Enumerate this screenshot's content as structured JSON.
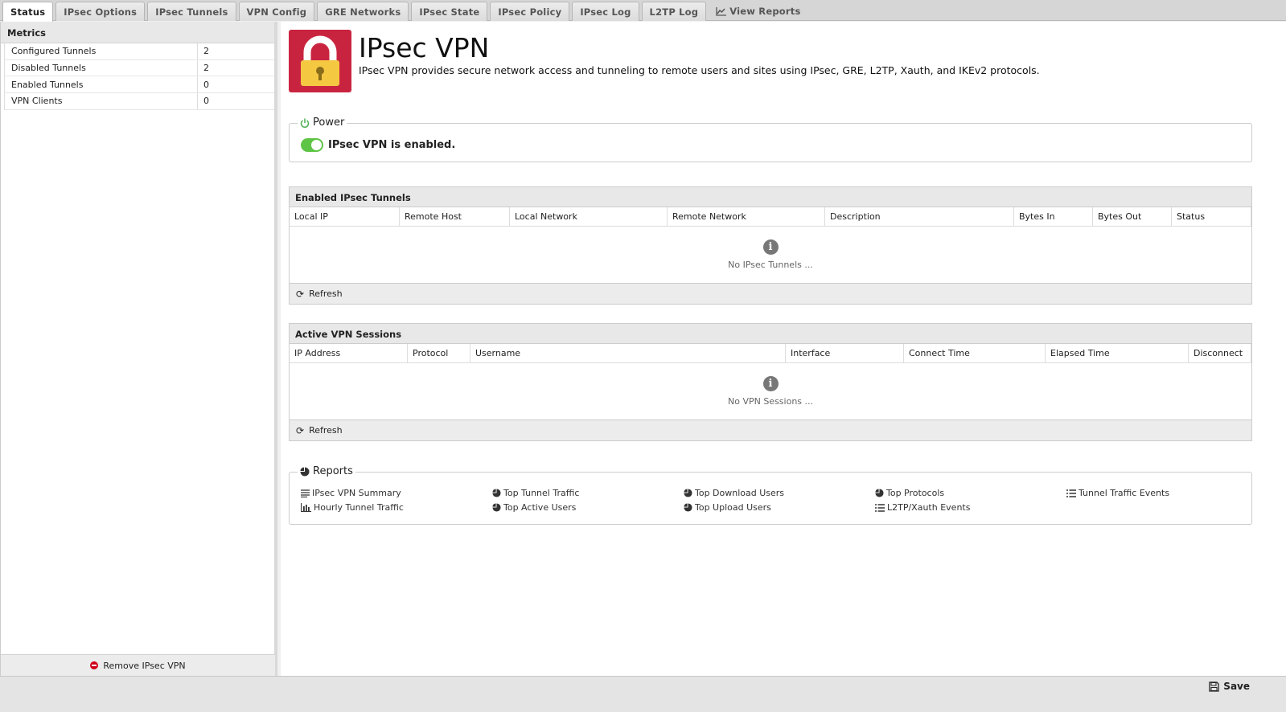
{
  "tabs": [
    {
      "label": "Status",
      "active": true
    },
    {
      "label": "IPsec Options"
    },
    {
      "label": "IPsec Tunnels"
    },
    {
      "label": "VPN Config"
    },
    {
      "label": "GRE Networks"
    },
    {
      "label": "IPsec State"
    },
    {
      "label": "IPsec Policy"
    },
    {
      "label": "IPsec Log"
    },
    {
      "label": "L2TP Log"
    },
    {
      "label": "View Reports",
      "icon": "line-chart-icon"
    }
  ],
  "metrics": {
    "title": "Metrics",
    "rows": [
      {
        "name": "Configured Tunnels",
        "value": "2"
      },
      {
        "name": "Disabled Tunnels",
        "value": "2"
      },
      {
        "name": "Enabled Tunnels",
        "value": "0"
      },
      {
        "name": "VPN Clients",
        "value": "0"
      }
    ],
    "remove_label": "Remove IPsec VPN"
  },
  "app": {
    "title": "IPsec VPN",
    "description": "IPsec VPN provides secure network access and tunneling to remote users and sites using IPsec, GRE, L2TP, Xauth, and IKEv2 protocols.",
    "icon": "padlock-icon",
    "accent": "#c9243f"
  },
  "power": {
    "legend": "Power",
    "status_text": "IPsec VPN is enabled.",
    "enabled": true,
    "toggle_color": "#5ec445"
  },
  "tunnels_panel": {
    "title": "Enabled IPsec Tunnels",
    "columns": [
      "Local IP",
      "Remote Host",
      "Local Network",
      "Remote Network",
      "Description",
      "Bytes In",
      "Bytes Out",
      "Status"
    ],
    "empty_text": "No IPsec Tunnels ...",
    "refresh_label": "Refresh"
  },
  "sessions_panel": {
    "title": "Active VPN Sessions",
    "columns": [
      "IP Address",
      "Protocol",
      "Username",
      "Interface",
      "Connect Time",
      "Elapsed Time",
      "Disconnect"
    ],
    "empty_text": "No VPN Sessions ...",
    "refresh_label": "Refresh"
  },
  "reports": {
    "legend": "Reports",
    "items": [
      {
        "label": "IPsec VPN Summary",
        "icon": "list-lines-icon"
      },
      {
        "label": "Top Tunnel Traffic",
        "icon": "pie-chart-icon"
      },
      {
        "label": "Top Download Users",
        "icon": "pie-chart-icon"
      },
      {
        "label": "Top Protocols",
        "icon": "pie-chart-icon"
      },
      {
        "label": "Tunnel Traffic Events",
        "icon": "list-icon"
      },
      {
        "label": "Hourly Tunnel Traffic",
        "icon": "bar-chart-icon"
      },
      {
        "label": "Top Active Users",
        "icon": "pie-chart-icon"
      },
      {
        "label": "Top Upload Users",
        "icon": "pie-chart-icon"
      },
      {
        "label": "L2TP/Xauth Events",
        "icon": "list-icon"
      }
    ]
  },
  "footer": {
    "save_label": "Save"
  }
}
